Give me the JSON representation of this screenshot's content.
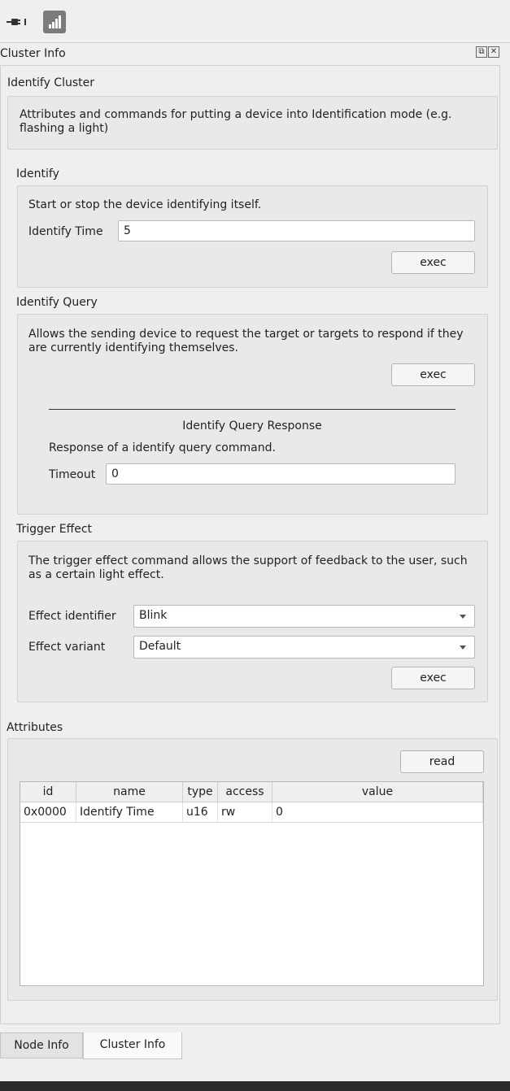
{
  "toolbar": {
    "plug_icon": "plug-icon",
    "signal_icon": "signal-bars-icon"
  },
  "dock": {
    "title": "Cluster Info",
    "float_icon": "float-icon",
    "close_icon": "close-icon"
  },
  "cluster": {
    "title": "Identify Cluster",
    "description": "Attributes and commands for putting a device into Identification mode (e.g. flashing a light)"
  },
  "identify": {
    "title": "Identify",
    "description": "Start or stop the device identifying itself.",
    "time_label": "Identify Time",
    "time_value": "5",
    "exec_label": "exec"
  },
  "identify_query": {
    "title": "Identify Query",
    "description": "Allows the sending device to request the target or targets to respond if they are currently identifying themselves.",
    "exec_label": "exec",
    "response_title": "Identify Query Response",
    "response_description": "Response of a identify query command.",
    "timeout_label": "Timeout",
    "timeout_value": "0"
  },
  "trigger_effect": {
    "title": "Trigger Effect",
    "description": "The trigger effect command allows the support of feedback to the user, such as a certain light effect.",
    "effect_identifier_label": "Effect identifier",
    "effect_identifier_value": "Blink",
    "effect_variant_label": "Effect variant",
    "effect_variant_value": "Default",
    "exec_label": "exec"
  },
  "attributes": {
    "title": "Attributes",
    "read_label": "read",
    "columns": [
      "id",
      "name",
      "type",
      "access",
      "value"
    ],
    "rows": [
      {
        "id": "0x0000",
        "name": "Identify Time",
        "type": "u16",
        "access": "rw",
        "value": "0"
      }
    ]
  },
  "tabs": [
    "Node Info",
    "Cluster Info"
  ]
}
